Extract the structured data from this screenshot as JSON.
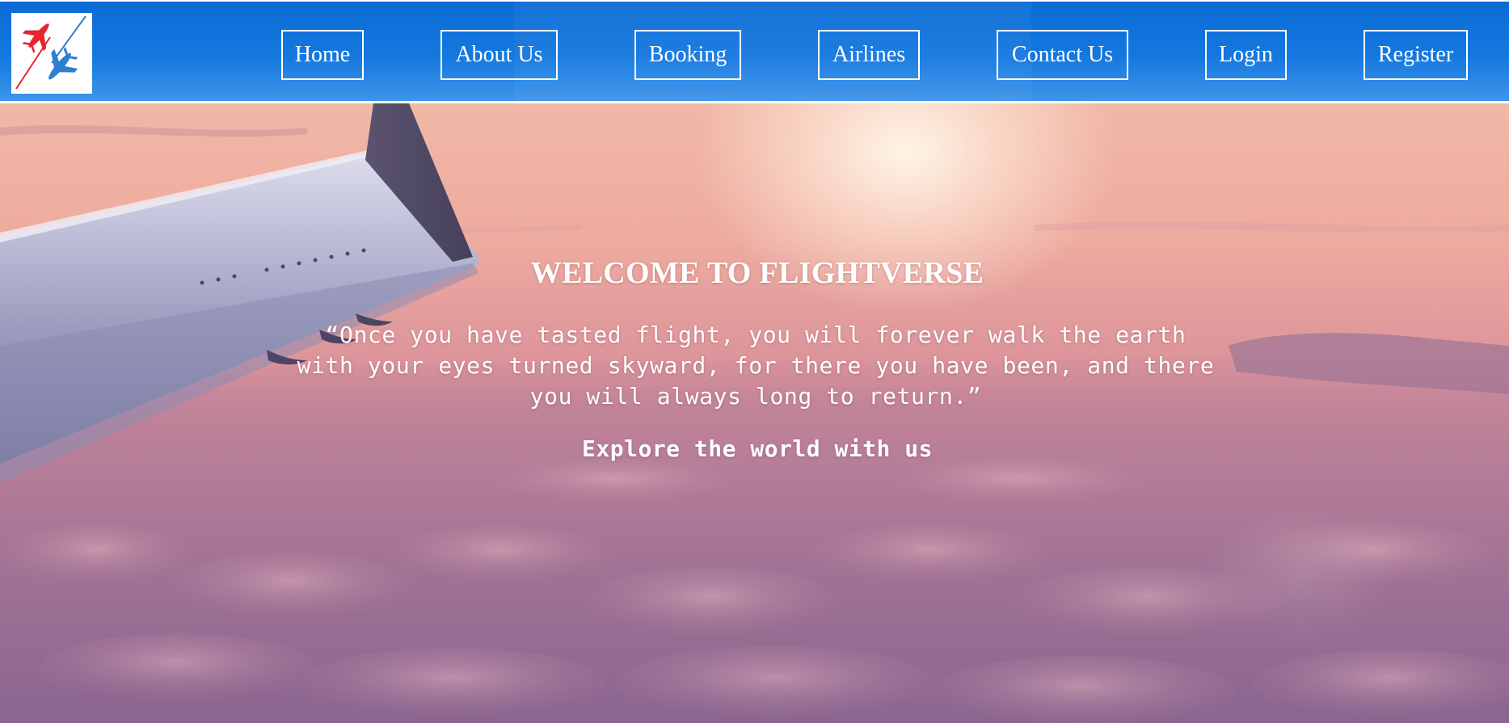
{
  "nav": {
    "items": [
      {
        "label": "Home"
      },
      {
        "label": "About Us"
      },
      {
        "label": "Booking"
      },
      {
        "label": "Airlines"
      },
      {
        "label": "Contact Us"
      },
      {
        "label": "Login"
      },
      {
        "label": "Register"
      }
    ]
  },
  "hero": {
    "title": "WELCOME TO FLIGHTVERSE",
    "quote": "“Once you have tasted flight, you will forever walk the earth with your eyes turned skyward, for there you have been, and there you will always long to return.”",
    "tagline": "Explore the world with us"
  },
  "colors": {
    "header_blue": "#0b6bd6",
    "logo_red": "#e8242c",
    "logo_blue": "#2f7fd1",
    "text": "#ffffff"
  },
  "icons": {
    "logo": "crossed-airplanes-logo-icon",
    "background": "airplane-wing-above-clouds-image"
  }
}
